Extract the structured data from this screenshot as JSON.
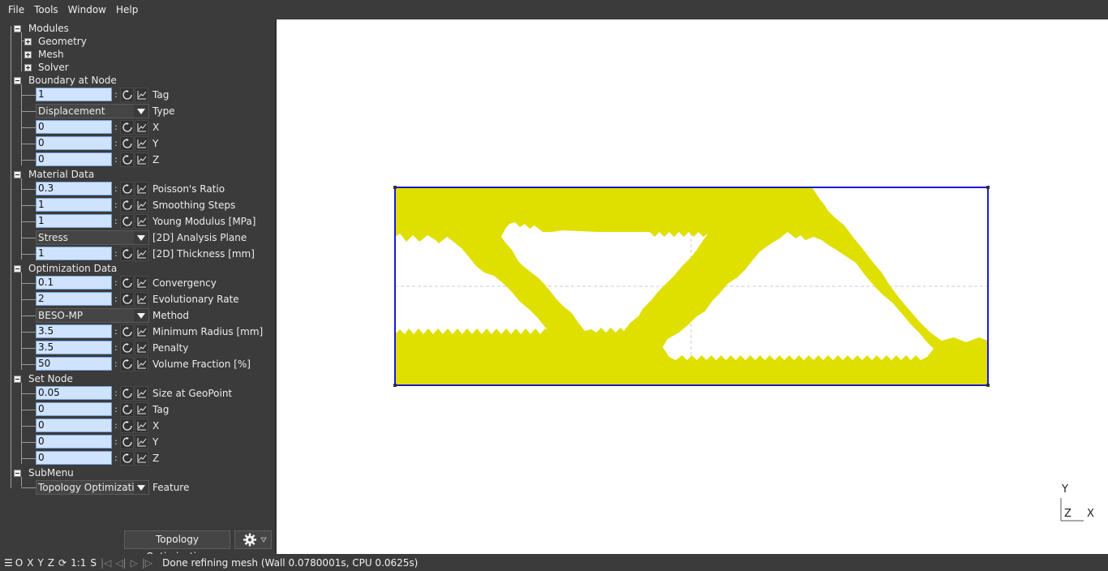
{
  "menu": {
    "file": "File",
    "tools": "Tools",
    "window": "Window",
    "help": "Help"
  },
  "tree": {
    "modules": "Modules",
    "geometry": "Geometry",
    "mesh": "Mesh",
    "solver": "Solver",
    "boundary": {
      "title": "Boundary at Node",
      "tag_value": "1",
      "tag_label": "Tag",
      "type_value": "Displacement",
      "type_label": "Type",
      "x_value": "0",
      "x_label": "X",
      "y_value": "0",
      "y_label": "Y",
      "z_value": "0",
      "z_label": "Z"
    },
    "material": {
      "title": "Material Data",
      "poisson_value": "0.3",
      "poisson_label": "Poisson's Ratio",
      "smoothing_value": "1",
      "smoothing_label": "Smoothing Steps",
      "young_value": "1",
      "young_label": "Young Modulus [MPa]",
      "plane_value": "Stress",
      "plane_label": "[2D] Analysis Plane",
      "thickness_value": "1",
      "thickness_label": "[2D] Thickness [mm]"
    },
    "optimization": {
      "title": "Optimization Data",
      "convergency_value": "0.1",
      "convergency_label": "Convergency",
      "evo_value": "2",
      "evo_label": "Evolutionary Rate",
      "method_value": "BESO-MP",
      "method_label": "Method",
      "radius_value": "3.5",
      "radius_label": "Minimum Radius [mm]",
      "penalty_value": "3.5",
      "penalty_label": "Penalty",
      "volume_value": "50",
      "volume_label": "Volume Fraction [%]"
    },
    "setnode": {
      "title": "Set Node",
      "size_value": "0.05",
      "size_label": "Size at GeoPoint",
      "tag_value": "0",
      "tag_label": "Tag",
      "x_value": "0",
      "x_label": "X",
      "y_value": "0",
      "y_label": "Y",
      "z_value": "0",
      "z_label": "Z"
    },
    "submenu": {
      "title": "SubMenu",
      "feature_value": "Topology Optimization",
      "feature_label": "Feature"
    }
  },
  "run_button": "Topology Optimization",
  "statusbar": {
    "o": "O",
    "x": "X",
    "y": "Y",
    "z": "Z",
    "scale": "1:1",
    "s": "S",
    "message": "Done refining mesh (Wall 0.0780001s, CPU 0.0625s)"
  },
  "axis": {
    "y": "Y",
    "z": "Z",
    "x": "X"
  },
  "colors": {
    "shape_fill": "#dfdf00",
    "frame": "#1a1ad0",
    "input_bg": "#cfe3ff"
  }
}
